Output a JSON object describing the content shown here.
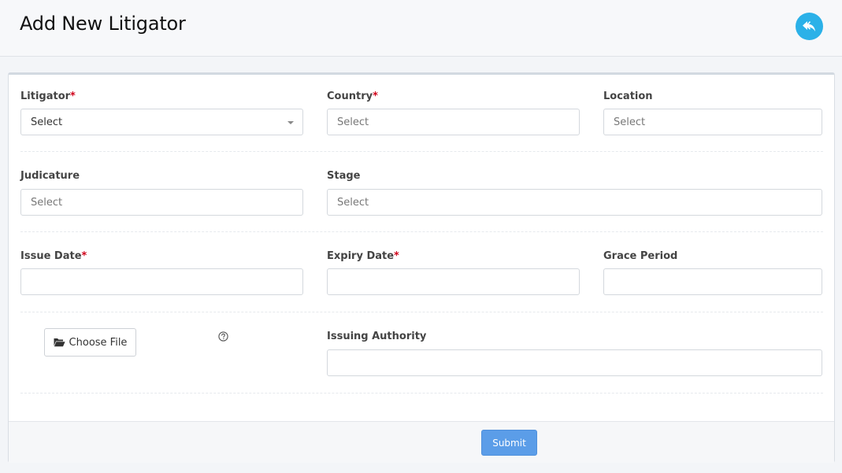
{
  "header": {
    "title": "Add New Litigator",
    "back_icon": "reply-arrow-icon",
    "accent_color": "#2bb1e8"
  },
  "form": {
    "required_marker": "*",
    "litigator": {
      "label": "Litigator",
      "required": true,
      "value": "Select"
    },
    "country": {
      "label": "Country",
      "required": true,
      "placeholder": "Select"
    },
    "location": {
      "label": "Location",
      "required": false,
      "placeholder": "Select"
    },
    "judicature": {
      "label": "Judicature",
      "required": false,
      "placeholder": "Select"
    },
    "stage": {
      "label": "Stage",
      "required": false,
      "placeholder": "Select"
    },
    "issue_date": {
      "label": "Issue Date",
      "required": true,
      "value": ""
    },
    "expiry_date": {
      "label": "Expiry Date",
      "required": true,
      "value": ""
    },
    "grace_period": {
      "label": "Grace Period",
      "required": false,
      "value": ""
    },
    "choose_file": {
      "label": "Choose File",
      "icon": "folder-open-icon"
    },
    "help_icon": "question-circle-icon",
    "issuing_authority": {
      "label": "Issuing Authority",
      "required": false,
      "value": ""
    }
  },
  "footer": {
    "submit_label": "Submit",
    "submit_color": "#5b9de8"
  }
}
